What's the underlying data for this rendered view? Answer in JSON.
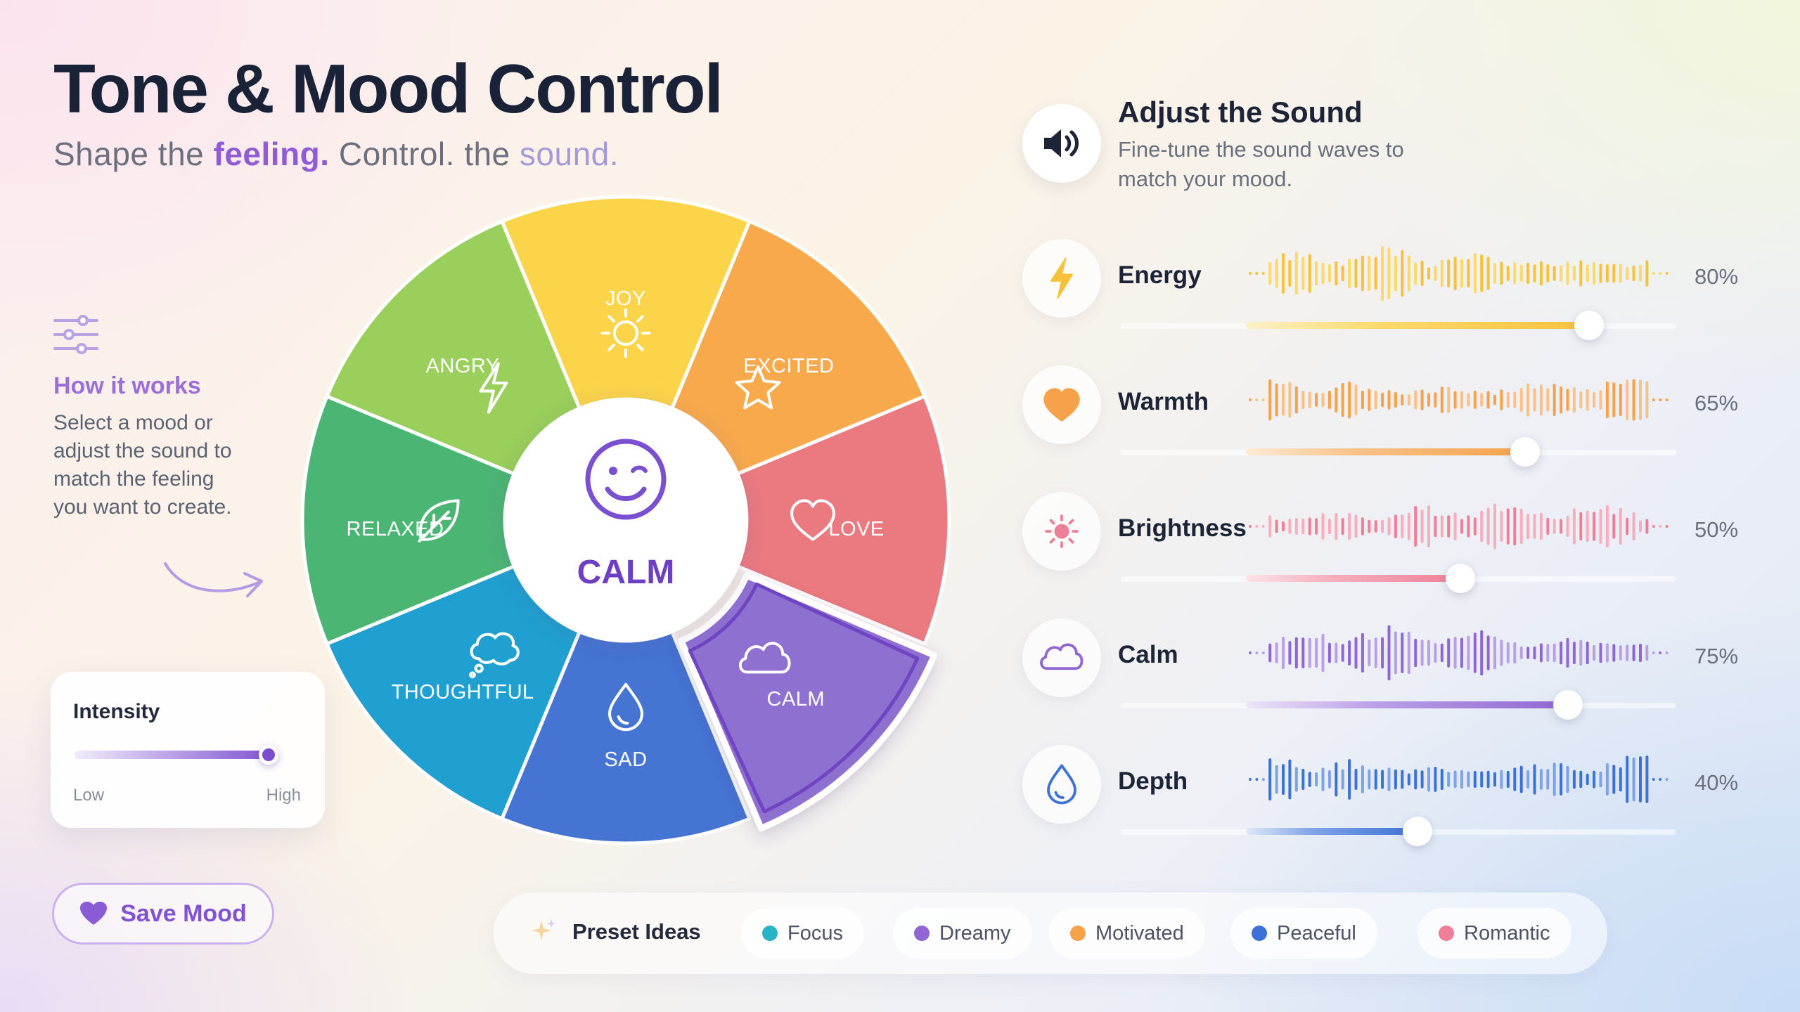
{
  "header": {
    "title": "Tone & Mood Control",
    "subtitle_part1": "Shape the ",
    "subtitle_accent1": "feeling.",
    "subtitle_part2": " Control. the ",
    "subtitle_accent2": "sound."
  },
  "how_it_works": {
    "title": "How it works",
    "text": "Select a mood or adjust the sound to match the feeling you want to create."
  },
  "intensity": {
    "label": "Intensity",
    "low": "Low",
    "high": "High",
    "value": 0.95
  },
  "save_button": {
    "label": "Save Mood",
    "icon": "heart-icon"
  },
  "wheel": {
    "center_label": "CALM",
    "selected": "CALM",
    "segments": [
      {
        "label": "JOY",
        "icon": "sun-icon",
        "color": "#fbd44a"
      },
      {
        "label": "EXCITED",
        "icon": "star-icon",
        "color": "#f8a94c"
      },
      {
        "label": "LOVE",
        "icon": "heart-icon",
        "color": "#eb7a80"
      },
      {
        "label": "CALM",
        "icon": "cloud-icon",
        "color": "#8e6fd1"
      },
      {
        "label": "SAD",
        "icon": "drop-icon",
        "color": "#4574d3"
      },
      {
        "label": "THOUGHTFUL",
        "icon": "thought-cloud-icon",
        "color": "#1fa0d0"
      },
      {
        "label": "RELAXED",
        "icon": "leaf-icon",
        "color": "#4bb574"
      },
      {
        "label": "ANGRY",
        "icon": "bolt-icon",
        "color": "#99cf5a"
      }
    ]
  },
  "sound": {
    "title": "Adjust the Sound",
    "description": "Fine-tune the sound waves to match your mood.",
    "icon": "speaker-icon",
    "params": [
      {
        "name": "Energy",
        "value": 80,
        "pct_label": "80%",
        "icon": "bolt-icon",
        "color": "#f6c23c",
        "color2": "#fbd96a",
        "bg": "#fbf1c8"
      },
      {
        "name": "Warmth",
        "value": 65,
        "pct_label": "65%",
        "icon": "heart-icon",
        "color": "#f5a24a",
        "color2": "#f8c187",
        "bg": "#fdebd6"
      },
      {
        "name": "Brightness",
        "value": 50,
        "pct_label": "50%",
        "icon": "sun-icon",
        "color": "#ef7f98",
        "color2": "#f5aebd",
        "bg": "#fbe2e8"
      },
      {
        "name": "Calm",
        "value": 75,
        "pct_label": "75%",
        "icon": "cloud-icon",
        "color": "#9066d4",
        "color2": "#b9a0e6",
        "bg": "#ece4f7"
      },
      {
        "name": "Depth",
        "value": 40,
        "pct_label": "40%",
        "icon": "drop-icon",
        "color": "#3c72d6",
        "color2": "#7ea2e6",
        "bg": "#dde8f8"
      }
    ]
  },
  "presets": {
    "title": "Preset Ideas",
    "icon": "sparkle-icon",
    "items": [
      {
        "label": "Focus",
        "color": "#27b3c8"
      },
      {
        "label": "Dreamy",
        "color": "#9066d4"
      },
      {
        "label": "Motivated",
        "color": "#f5a24a"
      },
      {
        "label": "Peaceful",
        "color": "#3c72d6"
      },
      {
        "label": "Romantic",
        "color": "#ef7f98"
      }
    ]
  }
}
